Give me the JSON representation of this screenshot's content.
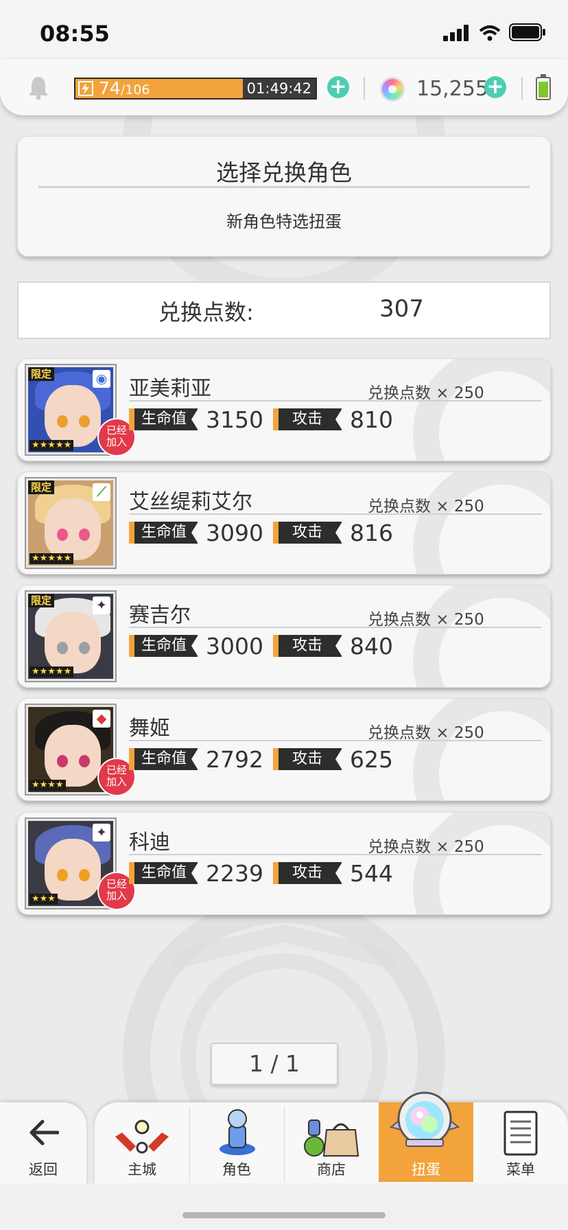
{
  "status_bar": {
    "time": "08:55"
  },
  "resources": {
    "stamina_current": "74",
    "stamina_max": "/106",
    "stamina_fraction": 0.698,
    "stamina_timer": "01:49:42",
    "gem_count": "15,255"
  },
  "header": {
    "title": "选择兑换角色",
    "subtitle": "新角色特选扭蛋"
  },
  "points": {
    "label": "兑换点数:",
    "value": "307"
  },
  "stat_labels": {
    "hp": "生命值",
    "atk": "攻击"
  },
  "badges": {
    "limited": "限定",
    "joined_line1": "已经",
    "joined_line2": "加入"
  },
  "characters": [
    {
      "name": "亚美莉亚",
      "cost": "兑换点数 × 250",
      "hp": "3150",
      "atk": "810",
      "stars": "★★★★★",
      "element_icon": "water-circle-icon",
      "limited": true,
      "joined": true
    },
    {
      "name": "艾丝缇莉艾尔",
      "cost": "兑换点数 × 250",
      "hp": "3090",
      "atk": "816",
      "stars": "★★★★★",
      "element_icon": "wind-leaf-icon",
      "limited": true,
      "joined": false
    },
    {
      "name": "赛吉尔",
      "cost": "兑换点数 × 250",
      "hp": "3000",
      "atk": "840",
      "stars": "★★★★★",
      "element_icon": "dark-star-icon",
      "limited": true,
      "joined": false
    },
    {
      "name": "舞姬",
      "cost": "兑换点数 × 250",
      "hp": "2792",
      "atk": "625",
      "stars": "★★★★",
      "element_icon": "fire-diamond-icon",
      "limited": false,
      "joined": true
    },
    {
      "name": "科迪",
      "cost": "兑换点数 × 250",
      "hp": "2239",
      "atk": "544",
      "stars": "★★★",
      "element_icon": "dark-star-icon",
      "limited": false,
      "joined": true
    }
  ],
  "pager": {
    "text": "1 / 1"
  },
  "nav": {
    "back": "返回",
    "items": [
      {
        "label": "主城",
        "icon": "castle-icon"
      },
      {
        "label": "角色",
        "icon": "character-icon"
      },
      {
        "label": "商店",
        "icon": "shop-bag-icon"
      },
      {
        "label": "扭蛋",
        "icon": "gacha-orb-icon"
      },
      {
        "label": "菜单",
        "icon": "menu-list-icon"
      }
    ],
    "active_index": 3
  },
  "colors": {
    "accent_orange": "#f2a33c",
    "plus_teal": "#4ecdb3",
    "joined_red": "#e23a4a",
    "background": "#ebebeb"
  }
}
